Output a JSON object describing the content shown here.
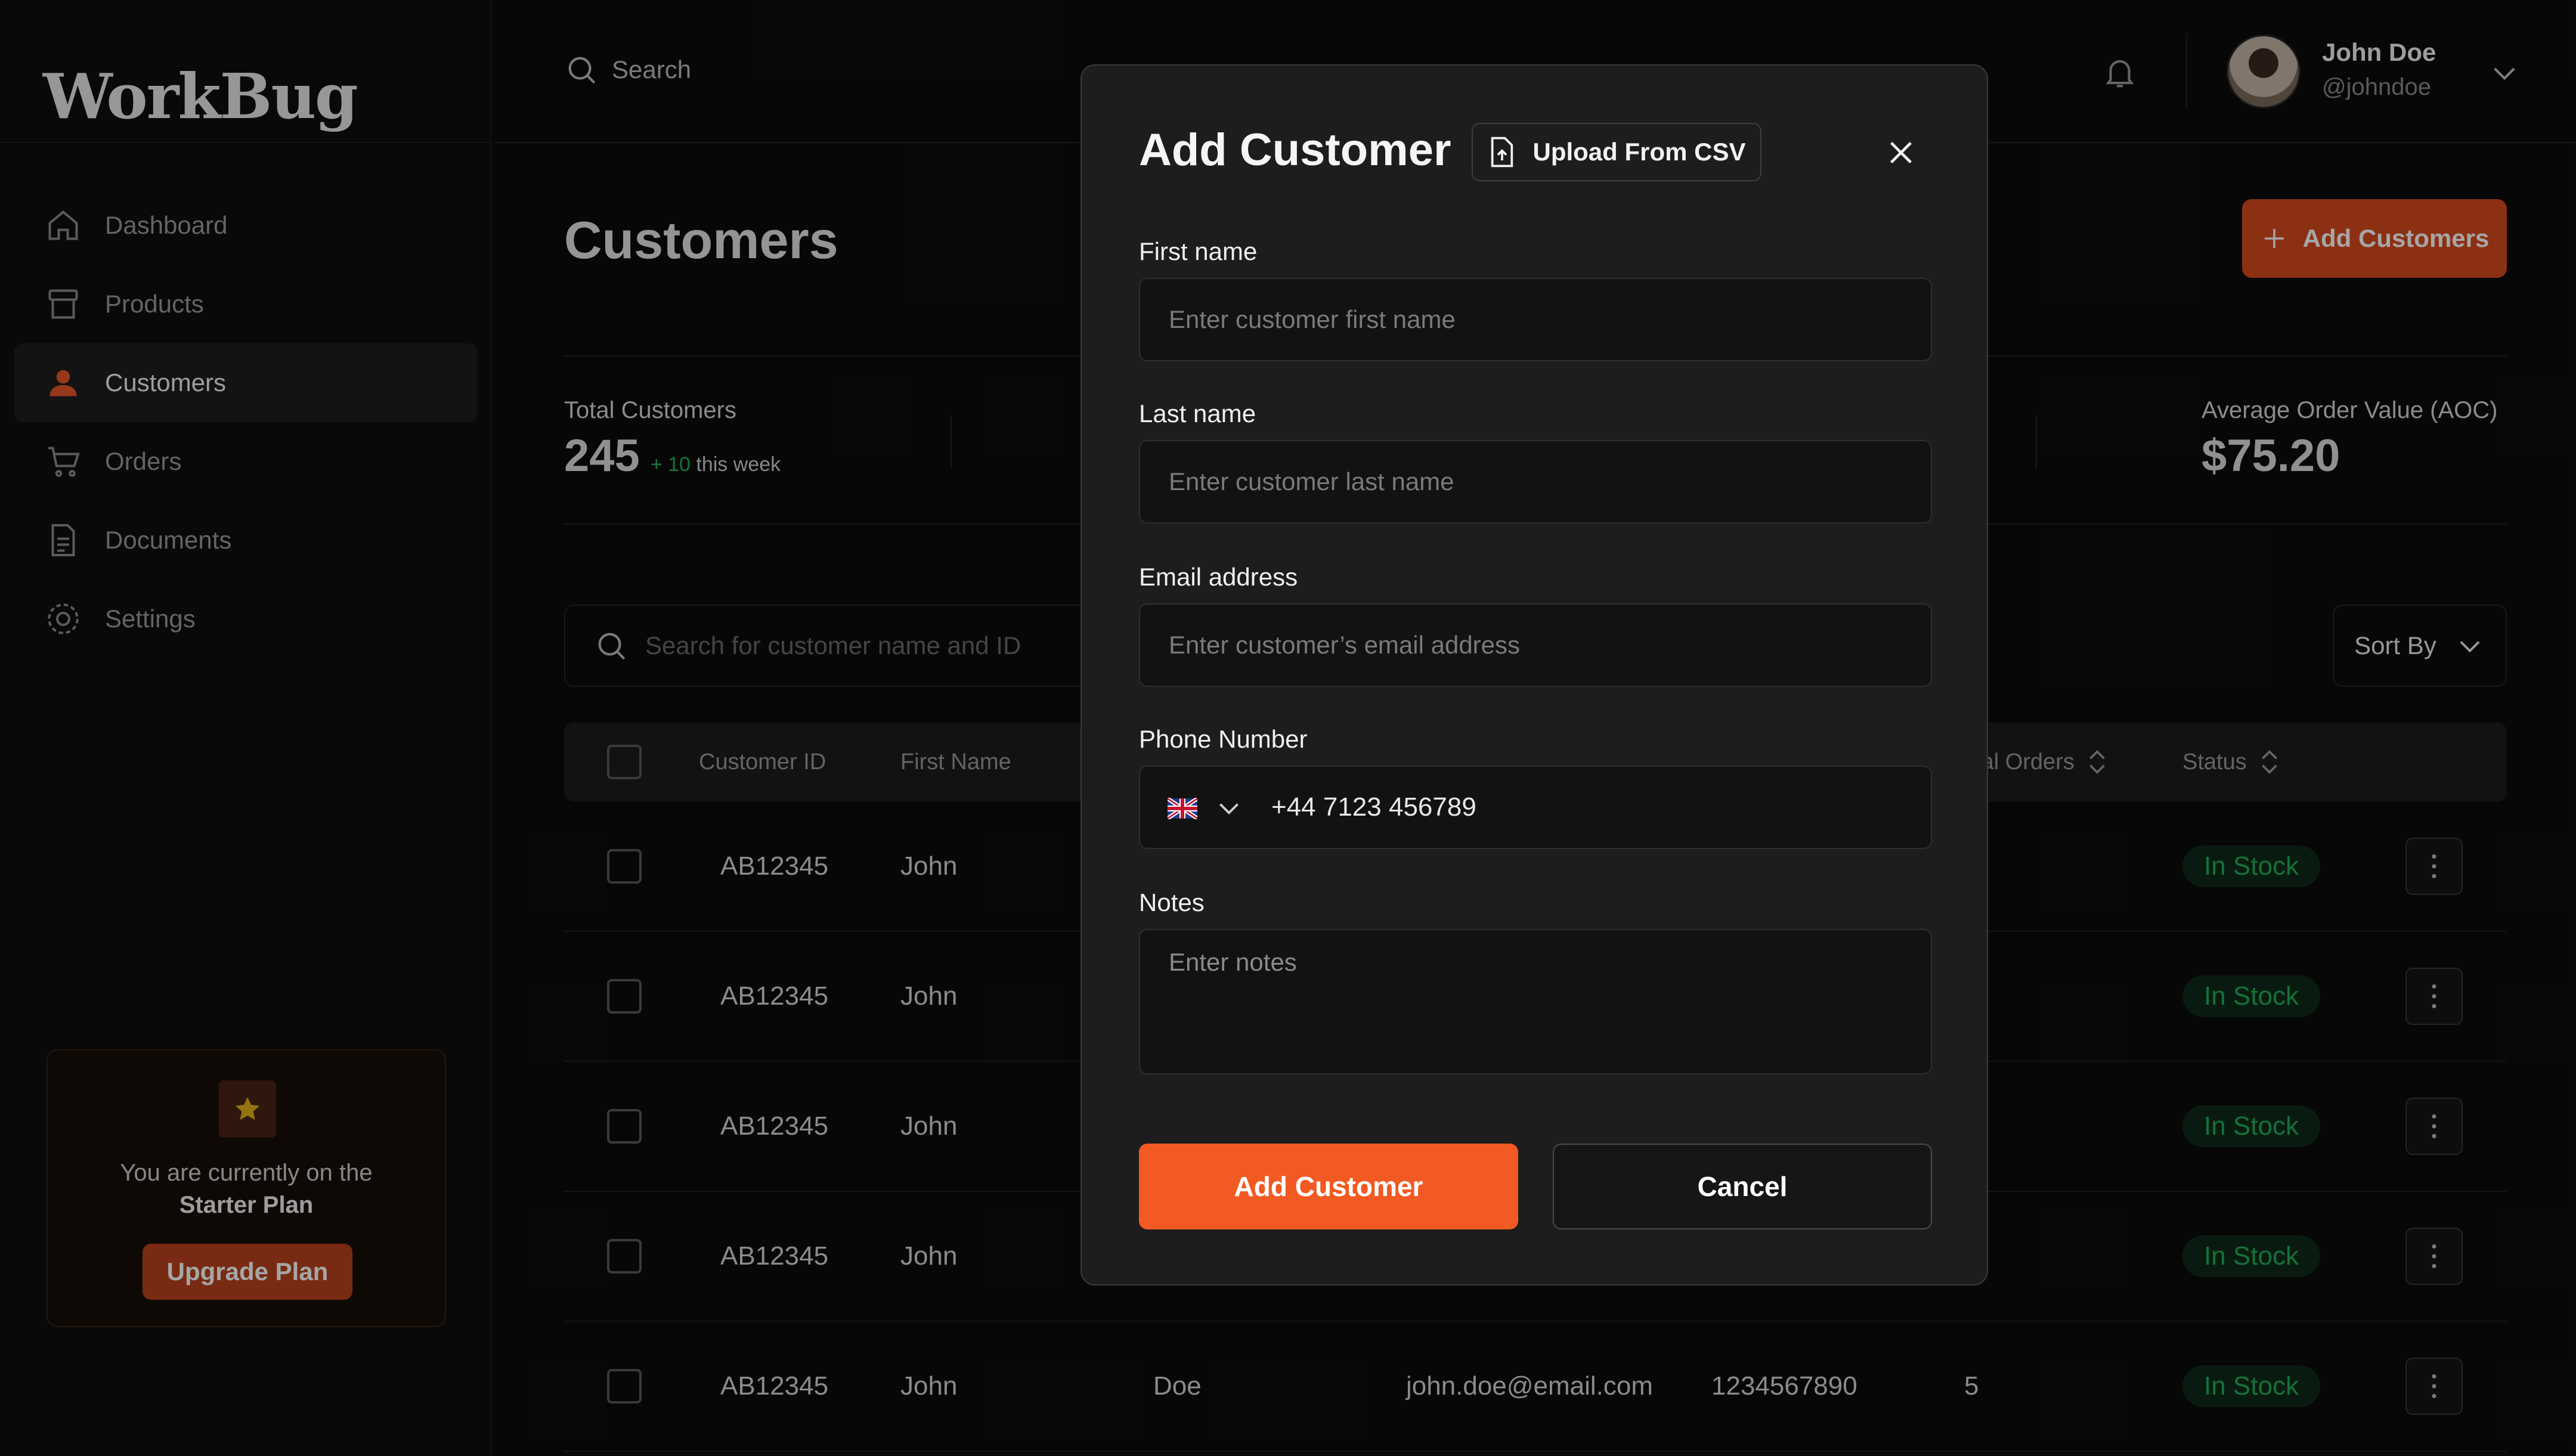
{
  "app": {
    "logo": "WorkBug"
  },
  "sidebar": {
    "items": [
      {
        "label": "Dashboard",
        "icon": "home-icon"
      },
      {
        "label": "Products",
        "icon": "box-icon"
      },
      {
        "label": "Customers",
        "icon": "users-icon",
        "active": true
      },
      {
        "label": "Orders",
        "icon": "cart-icon"
      },
      {
        "label": "Documents",
        "icon": "document-icon"
      },
      {
        "label": "Settings",
        "icon": "gear-icon"
      }
    ],
    "plan": {
      "line1": "You are currently on the",
      "plan_name": "Starter Plan",
      "upgrade_label": "Upgrade Plan"
    }
  },
  "header": {
    "search_label": "Search",
    "user": {
      "name": "John Doe",
      "handle": "@johndoe"
    }
  },
  "main": {
    "title": "Customers",
    "add_button_label": "Add Customers",
    "stats": {
      "total_customers": {
        "label": "Total Customers",
        "value": "245",
        "delta": "+ 10",
        "delta_suffix": "this week"
      },
      "aov": {
        "label": "Average Order Value (AOC)",
        "value": "$75.20"
      }
    },
    "search_placeholder": "Search for customer name and ID",
    "sort_label": "Sort By",
    "table": {
      "headers": {
        "customer_id": "Customer ID",
        "first_name": "First Name",
        "total_orders": "tal Orders",
        "status": "Status"
      },
      "rows": [
        {
          "id": "AB12345",
          "first_name": "John",
          "status": "In Stock"
        },
        {
          "id": "AB12345",
          "first_name": "John",
          "status": "In Stock"
        },
        {
          "id": "AB12345",
          "first_name": "John",
          "status": "In Stock"
        },
        {
          "id": "AB12345",
          "first_name": "John",
          "status": "In Stock"
        },
        {
          "id": "AB12345",
          "first_name": "John",
          "last_name": "Doe",
          "email": "john.doe@email.com",
          "phone": "1234567890",
          "orders": "5",
          "status": "In Stock"
        }
      ]
    }
  },
  "modal": {
    "title": "Add Customer",
    "upload_label": "Upload From CSV",
    "fields": {
      "first_name": {
        "label": "First name",
        "placeholder": "Enter customer first name"
      },
      "last_name": {
        "label": "Last name",
        "placeholder": "Enter customer last name"
      },
      "email": {
        "label": "Email address",
        "placeholder": "Enter customer’s email address"
      },
      "phone": {
        "label": "Phone Number",
        "value": "+44 7123 456789",
        "country": "UK"
      },
      "notes": {
        "label": "Notes",
        "placeholder": "Enter notes"
      }
    },
    "submit_label": "Add Customer",
    "cancel_label": "Cancel"
  },
  "colors": {
    "accent": "#f15a22",
    "background": "#0c0c0c",
    "modal_bg": "#1d1d1d",
    "status_green": "#1fae56"
  }
}
